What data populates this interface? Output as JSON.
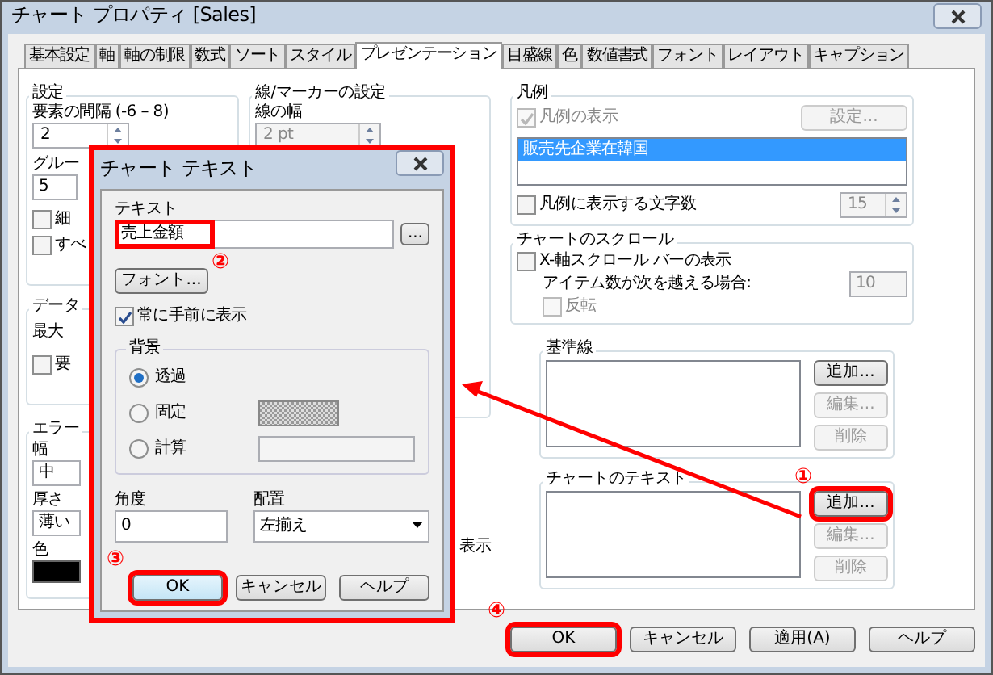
{
  "window": {
    "title": "チャート プロパティ [Sales]"
  },
  "tabs": [
    {
      "label": "基本設定",
      "selected": false
    },
    {
      "label": "軸",
      "selected": false
    },
    {
      "label": "軸の制限",
      "selected": false
    },
    {
      "label": "数式",
      "selected": false
    },
    {
      "label": "ソート",
      "selected": false
    },
    {
      "label": "スタイル",
      "selected": false
    },
    {
      "label": "プレゼンテーション",
      "selected": true
    },
    {
      "label": "目盛線",
      "selected": false
    },
    {
      "label": "色",
      "selected": false
    },
    {
      "label": "数値書式",
      "selected": false
    },
    {
      "label": "フォント",
      "selected": false
    },
    {
      "label": "レイアウト",
      "selected": false
    },
    {
      "label": "キャプション",
      "selected": false
    }
  ],
  "settings_group": {
    "title": "設定",
    "spacing_label": "要素の間隔 (-6 – 8)",
    "spacing_value": "2",
    "group_label": "グルー",
    "group_value": "5",
    "checkboxes": [
      {
        "label": "細",
        "checked": false
      },
      {
        "label": "すべ",
        "checked": false
      }
    ]
  },
  "data_group": {
    "title": "データ",
    "row_label": "最大",
    "checkbox": {
      "label": "要",
      "checked": false
    }
  },
  "error_group": {
    "title": "エラー",
    "width_label": "幅",
    "width_value": "中",
    "thickness_label": "厚さ",
    "thickness_value": "薄い",
    "color_label": "色"
  },
  "line_marker_group": {
    "title": "線/マーカーの設定",
    "line_width_label": "線の幅",
    "line_width_value": "2 pt",
    "line_width_disabled": true,
    "checkbox_tail": "表示"
  },
  "legend_group": {
    "title": "凡例",
    "show_legend": {
      "label": "凡例の表示",
      "checked": true,
      "disabled": true
    },
    "settings_button": {
      "label": "設定...",
      "disabled": true
    },
    "items": [
      {
        "label": "販売先企業在韓国",
        "selected": true
      }
    ],
    "char_count": {
      "label": "凡例に表示する文字数",
      "checked": false,
      "value": "15"
    }
  },
  "scroll_group": {
    "title": "チャートのスクロール",
    "show_scrollbar": {
      "label": "X-軸スクロール バーの表示",
      "checked": false
    },
    "threshold_label": "アイテム数が次を越える場合:",
    "threshold_value": "10",
    "reverse": {
      "label": "反転",
      "checked": false,
      "disabled": true
    }
  },
  "reference_lines_group": {
    "title": "基準線",
    "buttons": [
      {
        "label": "追加...",
        "disabled": false
      },
      {
        "label": "編集...",
        "disabled": true
      },
      {
        "label": "削除",
        "disabled": true
      }
    ]
  },
  "chart_text_group": {
    "title": "チャートのテキスト",
    "buttons": [
      {
        "label": "追加...",
        "disabled": false
      },
      {
        "label": "編集...",
        "disabled": true
      },
      {
        "label": "削除",
        "disabled": true
      }
    ]
  },
  "footer_buttons": [
    {
      "label": "OK"
    },
    {
      "label": "キャンセル"
    },
    {
      "label": "適用(A)"
    },
    {
      "label": "ヘルプ"
    }
  ],
  "text_dialog": {
    "title": "チャート テキスト",
    "text_label": "テキスト",
    "text_value": "売上金額",
    "browse_button": "...",
    "font_button": "フォント...",
    "always_front": {
      "label": "常に手前に表示",
      "checked": true
    },
    "background_title": "背景",
    "background_options": [
      {
        "label": "透過",
        "selected": true
      },
      {
        "label": "固定",
        "selected": false
      },
      {
        "label": "計算",
        "selected": false
      }
    ],
    "angle_label": "角度",
    "angle_value": "0",
    "alignment_label": "配置",
    "alignment_value": "左揃え",
    "buttons": [
      {
        "label": "OK"
      },
      {
        "label": "キャンセル"
      },
      {
        "label": "ヘルプ"
      }
    ]
  },
  "annotations": [
    {
      "label": "①"
    },
    {
      "label": "②"
    },
    {
      "label": "③"
    },
    {
      "label": "④"
    }
  ]
}
